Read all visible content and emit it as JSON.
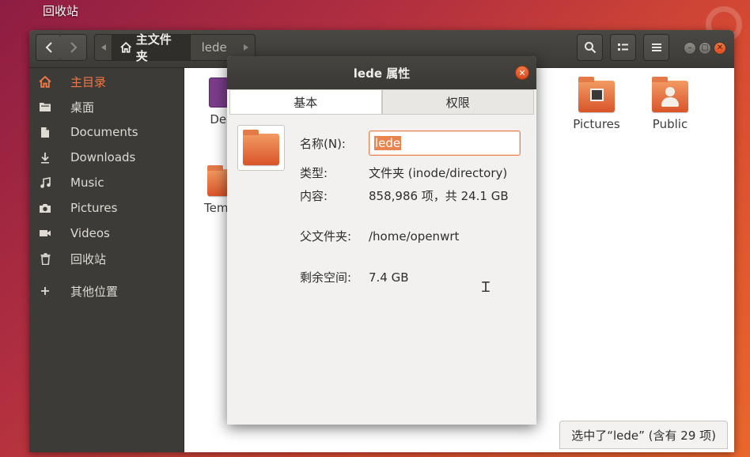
{
  "desktop": {
    "trash_label": "回收站"
  },
  "files_window": {
    "path": {
      "home_label": "主文件夹",
      "current_label": "lede"
    },
    "sidebar": {
      "items": [
        {
          "label": "主目录",
          "icon": "home-icon",
          "active": true
        },
        {
          "label": "桌面",
          "icon": "desktop-folder-icon"
        },
        {
          "label": "Documents",
          "icon": "document-icon"
        },
        {
          "label": "Downloads",
          "icon": "download-icon"
        },
        {
          "label": "Music",
          "icon": "music-icon"
        },
        {
          "label": "Pictures",
          "icon": "camera-icon"
        },
        {
          "label": "Videos",
          "icon": "video-icon"
        },
        {
          "label": "回收站",
          "icon": "trash-icon"
        },
        {
          "label": "其他位置",
          "icon": "plus-icon"
        }
      ]
    },
    "content": {
      "items": [
        {
          "label": "Desk",
          "icon": "desktop-folder-icon"
        },
        {
          "label": "Temp",
          "icon": "templates-folder-icon"
        },
        {
          "label": "Pictures",
          "icon": "pictures-folder-icon"
        },
        {
          "label": "Public",
          "icon": "public-folder-icon"
        }
      ]
    },
    "status": "选中了“lede” (含有 29 项)"
  },
  "dialog": {
    "title": "lede 属性",
    "tabs": [
      {
        "label": "基本",
        "active": true
      },
      {
        "label": "权限",
        "active": false
      }
    ],
    "properties": {
      "name_label": "名称(N):",
      "name_value": "lede",
      "type_label": "类型:",
      "type_value": "文件夹 (inode/directory)",
      "contents_label": "内容:",
      "contents_value": "858,986 项，共 24.1 GB",
      "parent_label": "父文件夹:",
      "parent_value": "/home/openwrt",
      "free_label": "剩余空间:",
      "free_value": "7.4 GB"
    }
  },
  "colors": {
    "accent": "#e9844e",
    "headerbar": "#3d3b37",
    "sidebar": "#3c3b37",
    "close": "#e25c29"
  }
}
